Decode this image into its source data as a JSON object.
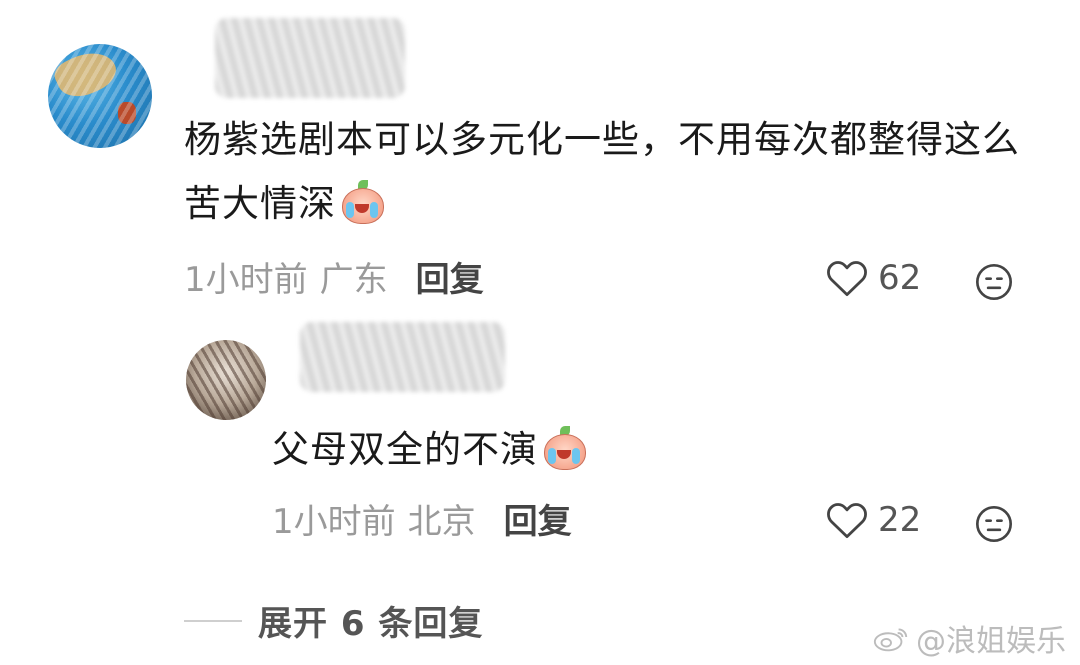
{
  "comments": [
    {
      "text": "杨紫选剧本可以多元化一些，不用每次都整得这么苦大情深",
      "time": "1小时前",
      "location": "广东",
      "reply_label": "回复",
      "likes": "62",
      "emoji": "crying-peach-emoji"
    },
    {
      "text": "父母双全的不演",
      "time": "1小时前",
      "location": "北京",
      "reply_label": "回复",
      "likes": "22",
      "emoji": "crying-peach-emoji"
    }
  ],
  "expand_label": "展开 6 条回复",
  "watermark": "@浪姐娱乐",
  "icons": {
    "like": "heart-outline-icon",
    "dislike": "meh-face-icon",
    "watermark_logo": "weibo-logo"
  },
  "colors": {
    "text": "#1a1a1a",
    "meta": "#9a9a9a",
    "action": "#444444"
  }
}
